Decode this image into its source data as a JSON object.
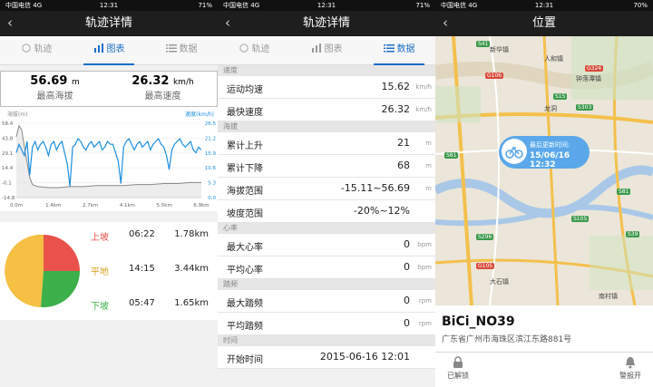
{
  "status": {
    "left": {
      "carrier": "中国电信",
      "net": "4G",
      "time": "12:31",
      "battery": "71%"
    },
    "mid": {
      "carrier": "中国电信",
      "net": "4G",
      "time": "12:31",
      "battery": "71%"
    },
    "right": {
      "carrier": "中国电信",
      "net": "4G",
      "time": "12:31",
      "battery": "70%"
    }
  },
  "screen1": {
    "title": "轨迹详情",
    "tabs": [
      "轨迹",
      "图表",
      "数据"
    ],
    "active_tab": 1,
    "stats": [
      {
        "value": "56.69",
        "unit": "m",
        "label": "最高海拔"
      },
      {
        "value": "26.32",
        "unit": "km/h",
        "label": "最高速度"
      }
    ],
    "pie_rows": [
      {
        "label": "上坡",
        "time": "06:22",
        "dist": "1.78km",
        "color": "#e8524a"
      },
      {
        "label": "平地",
        "time": "14:15",
        "dist": "3.44km",
        "color": "#f5c044"
      },
      {
        "label": "下坡",
        "time": "05:47",
        "dist": "1.65km",
        "color": "#3cb04a"
      }
    ]
  },
  "chart_data": {
    "type": "line",
    "left_label": "海拔(m)",
    "right_label": "速度(km/h)",
    "left_ticks": [
      "58.4",
      "43.8",
      "29.1",
      "14.4",
      "-0.1",
      "-14.8"
    ],
    "right_ticks": [
      "26.5",
      "21.2",
      "15.9",
      "10.6",
      "5.3",
      "0.0"
    ],
    "x_ticks": [
      "0.0m",
      "1.4km",
      "2.7km",
      "4.1km",
      "5.5km",
      "6.9km"
    ],
    "ylim_left": [
      -14.8,
      58.4
    ],
    "ylim_right": [
      0.0,
      26.5
    ],
    "xlim": [
      0,
      6.9
    ],
    "series": [
      {
        "color": "#888888",
        "x": [
          0,
          0.1,
          0.2,
          0.3,
          0.4,
          0.5,
          0.6,
          0.8,
          1.2,
          1.6,
          2.0,
          2.5,
          3.0,
          3.5,
          4.0,
          4.5,
          5.0,
          5.5,
          6.0,
          6.5,
          6.9
        ],
        "y": [
          45,
          56,
          52,
          35,
          20,
          5,
          -2,
          -4,
          -5,
          -5,
          -4,
          -4,
          -3,
          -3,
          -3,
          -2,
          -2,
          -1,
          -1,
          0,
          0
        ]
      },
      {
        "color": "#1a8fe0",
        "x": [
          0,
          0.1,
          0.2,
          0.3,
          0.4,
          0.5,
          0.6,
          0.7,
          0.8,
          0.9,
          1.0,
          1.1,
          1.2,
          1.3,
          1.4,
          1.5,
          1.6,
          1.7,
          1.8,
          1.9,
          2.0,
          2.1,
          2.2,
          2.3,
          2.4,
          2.5,
          2.6,
          2.7,
          2.8,
          2.9,
          3.0,
          3.1,
          3.2,
          3.3,
          3.4,
          3.5,
          3.6,
          3.7,
          3.8,
          3.9,
          4.0,
          4.1,
          4.2,
          4.3,
          4.4,
          4.5,
          4.6,
          4.7,
          4.8,
          4.9,
          5.0,
          5.1,
          5.2,
          5.3,
          5.4,
          5.5,
          5.6,
          5.7,
          5.8,
          5.9,
          6.0,
          6.1,
          6.2,
          6.3,
          6.4,
          6.5,
          6.6,
          6.7,
          6.8,
          6.9
        ],
        "y": [
          16,
          19,
          17,
          15,
          20,
          8,
          18,
          20,
          17,
          19,
          20,
          18,
          15,
          19,
          20,
          17,
          19,
          20,
          16,
          12,
          4,
          18,
          19,
          21,
          20,
          18,
          17,
          19,
          20,
          18,
          19,
          20,
          17,
          18,
          20,
          19,
          19,
          16,
          13,
          5,
          18,
          20,
          21,
          19,
          17,
          19,
          20,
          18,
          19,
          20,
          17,
          19,
          20,
          21,
          19,
          18,
          15,
          10,
          17,
          19,
          20,
          21,
          19,
          18,
          19,
          20,
          17,
          16,
          18,
          17
        ]
      }
    ]
  },
  "screen2": {
    "title": "轨迹详情",
    "tabs": [
      "轨迹",
      "图表",
      "数据"
    ],
    "active_tab": 2,
    "sections": [
      {
        "name": "速度",
        "rows": [
          {
            "k": "运动均速",
            "v": "15.62",
            "u": "km/h"
          },
          {
            "k": "最快速度",
            "v": "26.32",
            "u": "km/h"
          }
        ]
      },
      {
        "name": "海拔",
        "rows": [
          {
            "k": "累计上升",
            "v": "21",
            "u": "m"
          },
          {
            "k": "累计下降",
            "v": "68",
            "u": "m"
          },
          {
            "k": "海拔范围",
            "v": "-15.11~56.69",
            "u": "m"
          },
          {
            "k": "坡度范围",
            "v": "-20%~12%",
            "u": ""
          }
        ]
      },
      {
        "name": "心率",
        "rows": [
          {
            "k": "最大心率",
            "v": "0",
            "u": "bpm"
          },
          {
            "k": "平均心率",
            "v": "0",
            "u": "bpm"
          }
        ]
      },
      {
        "name": "踏频",
        "rows": [
          {
            "k": "最大踏频",
            "v": "0",
            "u": "rpm"
          },
          {
            "k": "平均踏频",
            "v": "0",
            "u": "rpm"
          }
        ]
      },
      {
        "name": "时间",
        "rows": [
          {
            "k": "开始时间",
            "v": "2015-06-16 12:01",
            "u": ""
          }
        ]
      }
    ]
  },
  "screen3": {
    "title": "位置",
    "bubble_label": "最后更新时间:",
    "bubble_time": "15/06/16 12:32",
    "bike_name": "BiCi_NO39",
    "address": "广东省广州市海珠区滨江东路881号",
    "unlock_label": "已解锁",
    "alarm_label": "警报开",
    "road_labels": [
      "S41",
      "G106",
      "G324",
      "S15",
      "S303",
      "S81",
      "S105",
      "S296",
      "G105",
      "S81",
      "S39"
    ],
    "place_labels": [
      "人和镇",
      "钟落潭镇",
      "龙洞",
      "新华镇",
      "南村镇",
      "大石镇"
    ]
  }
}
